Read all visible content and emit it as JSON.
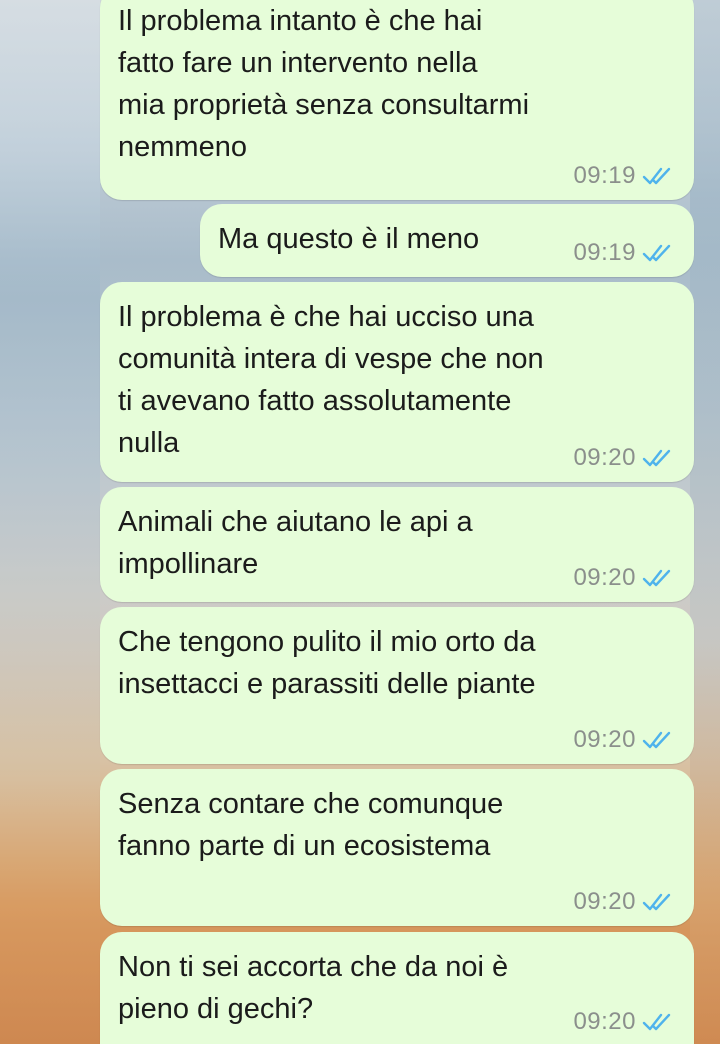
{
  "chat": {
    "messages": [
      {
        "text": "Il problema intanto è che hai\nfatto fare un intervento nella\nmia proprietà senza consultarmi\nnemmeno",
        "time": "09:19",
        "status": "read-icon"
      },
      {
        "text": "Ma questo è il meno",
        "time": "09:19",
        "status": "read-icon"
      },
      {
        "text": "Il problema è che hai ucciso una\ncomunità intera di vespe che non\nti avevano fatto assolutamente\nnulla",
        "time": "09:20",
        "status": "read-icon"
      },
      {
        "text": "Animali che aiutano le api a\nimpollinare",
        "time": "09:20",
        "status": "read-icon"
      },
      {
        "text": "Che tengono pulito il mio orto da\ninsettacci e parassiti delle piante",
        "time": "09:20",
        "status": "read-icon"
      },
      {
        "text": "Senza contare che comunque\nfanno parte di un ecosistema",
        "time": "09:20",
        "status": "read-icon"
      },
      {
        "text": "Non ti sei accorta che da noi è\npieno di gechi?",
        "time": "09:20",
        "status": "read-icon"
      }
    ]
  },
  "colors": {
    "bubble": "#e6fdd9",
    "text": "#1b1b1b",
    "time": "#8b8f8c",
    "read_ticks": "#4fb3ec"
  }
}
